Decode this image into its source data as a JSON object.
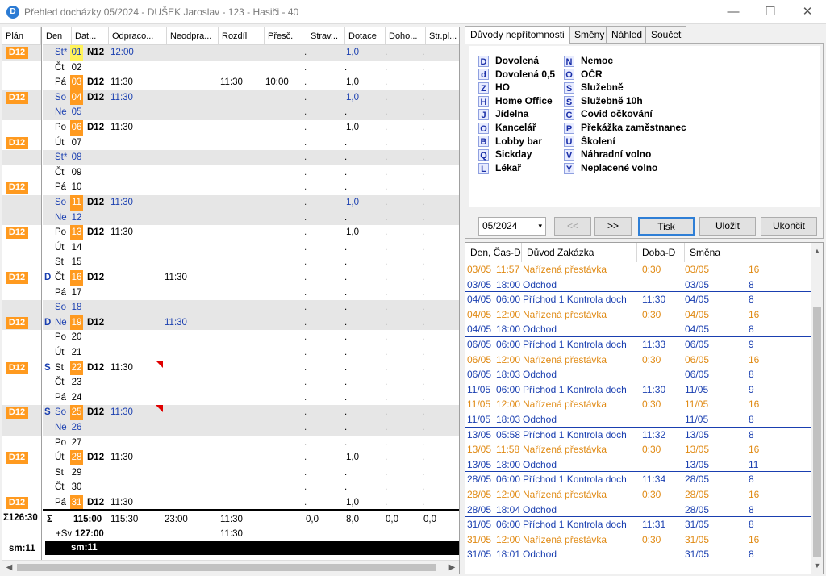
{
  "window": {
    "title": "Přehled docházky 05/2024 - DUŠEK Jaroslav - 123 - Hasiči - 40",
    "minimize": "—",
    "maximize": "☐",
    "close": "✕"
  },
  "grid": {
    "columns": [
      "Plán",
      "Den",
      "Dat...",
      "Odpraco...",
      "Neodpra...",
      "Rozdíl",
      "Přesč.",
      "Strav...",
      "Dotace",
      "Doho...",
      "Str.pl..."
    ],
    "rows": [
      {
        "plan": "D12",
        "day": "St*",
        "date": "01",
        "shift": "N12",
        "worked": "12:00",
        "unworked": "",
        "diff": "",
        "over": "",
        "meal": ".",
        "subsidy": "1,0",
        "agree": ".",
        "strpl": ".",
        "shade": true,
        "blue": true,
        "datehl": "y"
      },
      {
        "plan": "",
        "day": "Čt",
        "date": "02",
        "shift": "",
        "worked": "",
        "unworked": "",
        "diff": "",
        "over": "",
        "meal": ".",
        "subsidy": ".",
        "agree": ".",
        "strpl": ".",
        "shade": false,
        "blue": false,
        "datehl": ""
      },
      {
        "plan": "",
        "day": "Pá",
        "date": "03",
        "shift": "D12",
        "worked": "11:30",
        "unworked": "",
        "diff": "11:30",
        "over": "10:00",
        "meal": ".",
        "subsidy": "1,0",
        "agree": ".",
        "strpl": ".",
        "shade": false,
        "blue": false,
        "datehl": "o"
      },
      {
        "plan": "D12",
        "day": "So",
        "date": "04",
        "shift": "D12",
        "worked": "11:30",
        "unworked": "",
        "diff": "",
        "over": "",
        "meal": ".",
        "subsidy": "1,0",
        "agree": ".",
        "strpl": ".",
        "shade": true,
        "blue": true,
        "datehl": "o"
      },
      {
        "plan": "",
        "day": "Ne",
        "date": "05",
        "shift": "",
        "worked": "",
        "unworked": "",
        "diff": "",
        "over": "",
        "meal": ".",
        "subsidy": ".",
        "agree": ".",
        "strpl": ".",
        "shade": true,
        "blue": true,
        "datehl": ""
      },
      {
        "plan": "",
        "day": "Po",
        "date": "06",
        "shift": "D12",
        "worked": "11:30",
        "unworked": "",
        "diff": "",
        "over": "",
        "meal": ".",
        "subsidy": "1,0",
        "agree": ".",
        "strpl": ".",
        "shade": false,
        "blue": false,
        "datehl": "o"
      },
      {
        "plan": "D12",
        "day": "Út",
        "date": "07",
        "shift": "",
        "worked": "",
        "unworked": "",
        "diff": "",
        "over": "",
        "meal": ".",
        "subsidy": ".",
        "agree": ".",
        "strpl": ".",
        "shade": false,
        "blue": false,
        "datehl": ""
      },
      {
        "plan": "",
        "day": "St*",
        "date": "08",
        "shift": "",
        "worked": "",
        "unworked": "",
        "diff": "",
        "over": "",
        "meal": ".",
        "subsidy": ".",
        "agree": ".",
        "strpl": ".",
        "shade": true,
        "blue": true,
        "datehl": ""
      },
      {
        "plan": "",
        "day": "Čt",
        "date": "09",
        "shift": "",
        "worked": "",
        "unworked": "",
        "diff": "",
        "over": "",
        "meal": ".",
        "subsidy": ".",
        "agree": ".",
        "strpl": ".",
        "shade": false,
        "blue": false,
        "datehl": ""
      },
      {
        "plan": "D12",
        "day": "Pá",
        "date": "10",
        "shift": "",
        "worked": "",
        "unworked": "",
        "diff": "",
        "over": "",
        "meal": ".",
        "subsidy": ".",
        "agree": ".",
        "strpl": ".",
        "shade": false,
        "blue": false,
        "datehl": ""
      },
      {
        "plan": "",
        "day": "So",
        "date": "11",
        "shift": "D12",
        "worked": "11:30",
        "unworked": "",
        "diff": "",
        "over": "",
        "meal": ".",
        "subsidy": "1,0",
        "agree": ".",
        "strpl": ".",
        "shade": true,
        "blue": true,
        "datehl": "o"
      },
      {
        "plan": "",
        "day": "Ne",
        "date": "12",
        "shift": "",
        "worked": "",
        "unworked": "",
        "diff": "",
        "over": "",
        "meal": ".",
        "subsidy": ".",
        "agree": ".",
        "strpl": ".",
        "shade": true,
        "blue": true,
        "datehl": ""
      },
      {
        "plan": "D12",
        "day": "Po",
        "date": "13",
        "shift": "D12",
        "worked": "11:30",
        "unworked": "",
        "diff": "",
        "over": "",
        "meal": ".",
        "subsidy": "1,0",
        "agree": ".",
        "strpl": ".",
        "shade": false,
        "blue": false,
        "datehl": "o"
      },
      {
        "plan": "",
        "day": "Út",
        "date": "14",
        "shift": "",
        "worked": "",
        "unworked": "",
        "diff": "",
        "over": "",
        "meal": ".",
        "subsidy": ".",
        "agree": ".",
        "strpl": ".",
        "shade": false,
        "blue": false,
        "datehl": ""
      },
      {
        "plan": "",
        "day": "St",
        "date": "15",
        "shift": "",
        "worked": "",
        "unworked": "",
        "diff": "",
        "over": "",
        "meal": ".",
        "subsidy": ".",
        "agree": ".",
        "strpl": ".",
        "shade": false,
        "blue": false,
        "datehl": ""
      },
      {
        "plan": "D12",
        "reason": "D",
        "day": "Čt",
        "date": "16",
        "shift": "D12",
        "worked": "",
        "unworked": "11:30",
        "diff": "",
        "over": "",
        "meal": ".",
        "subsidy": ".",
        "agree": ".",
        "strpl": ".",
        "shade": false,
        "blue": false,
        "datehl": "o"
      },
      {
        "plan": "",
        "day": "Pá",
        "date": "17",
        "shift": "",
        "worked": "",
        "unworked": "",
        "diff": "",
        "over": "",
        "meal": ".",
        "subsidy": ".",
        "agree": ".",
        "strpl": ".",
        "shade": false,
        "blue": false,
        "datehl": ""
      },
      {
        "plan": "",
        "day": "So",
        "date": "18",
        "shift": "",
        "worked": "",
        "unworked": "",
        "diff": "",
        "over": "",
        "meal": ".",
        "subsidy": ".",
        "agree": ".",
        "strpl": ".",
        "shade": true,
        "blue": true,
        "datehl": ""
      },
      {
        "plan": "D12",
        "reason": "D",
        "day": "Ne",
        "date": "19",
        "shift": "D12",
        "worked": "",
        "unworked": "11:30",
        "diff": "",
        "over": "",
        "meal": ".",
        "subsidy": ".",
        "agree": ".",
        "strpl": ".",
        "shade": true,
        "blue": true,
        "datehl": "o"
      },
      {
        "plan": "",
        "day": "Po",
        "date": "20",
        "shift": "",
        "worked": "",
        "unworked": "",
        "diff": "",
        "over": "",
        "meal": ".",
        "subsidy": ".",
        "agree": ".",
        "strpl": ".",
        "shade": false,
        "blue": false,
        "datehl": ""
      },
      {
        "plan": "",
        "day": "Út",
        "date": "21",
        "shift": "",
        "worked": "",
        "unworked": "",
        "diff": "",
        "over": "",
        "meal": ".",
        "subsidy": ".",
        "agree": ".",
        "strpl": ".",
        "shade": false,
        "blue": false,
        "datehl": ""
      },
      {
        "plan": "D12",
        "reason": "S",
        "day": "St",
        "date": "22",
        "shift": "D12",
        "worked": "11:30",
        "unworked": "",
        "diff": "",
        "over": "",
        "meal": ".",
        "subsidy": ".",
        "agree": ".",
        "strpl": ".",
        "shade": false,
        "blue": false,
        "datehl": "o",
        "mark": true
      },
      {
        "plan": "",
        "day": "Čt",
        "date": "23",
        "shift": "",
        "worked": "",
        "unworked": "",
        "diff": "",
        "over": "",
        "meal": ".",
        "subsidy": ".",
        "agree": ".",
        "strpl": ".",
        "shade": false,
        "blue": false,
        "datehl": ""
      },
      {
        "plan": "",
        "day": "Pá",
        "date": "24",
        "shift": "",
        "worked": "",
        "unworked": "",
        "diff": "",
        "over": "",
        "meal": ".",
        "subsidy": ".",
        "agree": ".",
        "strpl": ".",
        "shade": false,
        "blue": false,
        "datehl": ""
      },
      {
        "plan": "D12",
        "reason": "S",
        "day": "So",
        "date": "25",
        "shift": "D12",
        "worked": "11:30",
        "unworked": "",
        "diff": "",
        "over": "",
        "meal": ".",
        "subsidy": ".",
        "agree": ".",
        "strpl": ".",
        "shade": true,
        "blue": true,
        "datehl": "o",
        "mark": true
      },
      {
        "plan": "",
        "day": "Ne",
        "date": "26",
        "shift": "",
        "worked": "",
        "unworked": "",
        "diff": "",
        "over": "",
        "meal": ".",
        "subsidy": ".",
        "agree": ".",
        "strpl": ".",
        "shade": true,
        "blue": true,
        "datehl": ""
      },
      {
        "plan": "",
        "day": "Po",
        "date": "27",
        "shift": "",
        "worked": "",
        "unworked": "",
        "diff": "",
        "over": "",
        "meal": ".",
        "subsidy": ".",
        "agree": ".",
        "strpl": ".",
        "shade": false,
        "blue": false,
        "datehl": ""
      },
      {
        "plan": "D12",
        "day": "Út",
        "date": "28",
        "shift": "D12",
        "worked": "11:30",
        "unworked": "",
        "diff": "",
        "over": "",
        "meal": ".",
        "subsidy": "1,0",
        "agree": ".",
        "strpl": ".",
        "shade": false,
        "blue": false,
        "datehl": "o"
      },
      {
        "plan": "",
        "day": "St",
        "date": "29",
        "shift": "",
        "worked": "",
        "unworked": "",
        "diff": "",
        "over": "",
        "meal": ".",
        "subsidy": ".",
        "agree": ".",
        "strpl": ".",
        "shade": false,
        "blue": false,
        "datehl": ""
      },
      {
        "plan": "",
        "day": "Čt",
        "date": "30",
        "shift": "",
        "worked": "",
        "unworked": "",
        "diff": "",
        "over": "",
        "meal": ".",
        "subsidy": ".",
        "agree": ".",
        "strpl": ".",
        "shade": false,
        "blue": false,
        "datehl": ""
      },
      {
        "plan": "D12",
        "day": "Pá",
        "date": "31",
        "shift": "D12",
        "worked": "11:30",
        "unworked": "",
        "diff": "",
        "over": "",
        "meal": ".",
        "subsidy": "1,0",
        "agree": ".",
        "strpl": ".",
        "shade": false,
        "blue": false,
        "datehl": "o"
      }
    ],
    "sum": {
      "plan": "Σ126:30",
      "sigma": "Σ",
      "total": "115:00",
      "worked": "115:30",
      "unworked": "23:00",
      "diff": "11:30",
      "meal": "0,0",
      "subsidy": "8,0",
      "agree": "0,0",
      "strpl": "0,0"
    },
    "sv": {
      "label": "+Sv",
      "total": "127:00",
      "diff": "11:30"
    },
    "sm": {
      "plan": "sm:11",
      "bar": "sm:11"
    }
  },
  "tabs": [
    "Důvody nepřítomnosti",
    "Směny",
    "Náhled",
    "Součet"
  ],
  "legend": [
    {
      "key": "D",
      "label": "Dovolená"
    },
    {
      "key": "d",
      "label": "Dovolená 0,5"
    },
    {
      "key": "Z",
      "label": "HO"
    },
    {
      "key": "H",
      "label": "Home Office"
    },
    {
      "key": "J",
      "label": "Jídelna"
    },
    {
      "key": "O",
      "label": "Kancelář"
    },
    {
      "key": "B",
      "label": "Lobby bar"
    },
    {
      "key": "Q",
      "label": "Sickday"
    },
    {
      "key": "L",
      "label": "Lékař"
    },
    {
      "key": "N",
      "label": "Nemoc"
    },
    {
      "key": "O",
      "label": "OČR"
    },
    {
      "key": "S",
      "label": "Služebně"
    },
    {
      "key": "S",
      "label": "Služebně 10h"
    },
    {
      "key": "C",
      "label": "Covid očkování"
    },
    {
      "key": "P",
      "label": "Překážka zaměstnanec"
    },
    {
      "key": "U",
      "label": "Školení"
    },
    {
      "key": "V",
      "label": "Náhradní volno"
    },
    {
      "key": "Y",
      "label": "Neplacené volno"
    }
  ],
  "controls": {
    "month": "05/2024",
    "prev": "<<",
    "next": ">>",
    "print": "Tisk",
    "save": "Uložit",
    "exit": "Ukončit"
  },
  "events": {
    "columns": [
      "Den, Čas-D",
      "Důvod Zakázka",
      "Doba-D",
      "Směna"
    ],
    "rows": [
      {
        "date": "03/05",
        "time": "11:57",
        "reason": "Nařízená přestávka",
        "dur": "0:30",
        "shift": "03/05",
        "n": "16",
        "color": "orange",
        "sep": false
      },
      {
        "date": "03/05",
        "time": "18:00",
        "reason": "Odchod",
        "dur": "",
        "shift": "03/05",
        "n": "8",
        "color": "blue",
        "sep": true
      },
      {
        "date": "04/05",
        "time": "06:00",
        "reason": "Příchod 1 Kontrola doch",
        "dur": "11:30",
        "shift": "04/05",
        "n": "8",
        "color": "blue",
        "sep": false
      },
      {
        "date": "04/05",
        "time": "12:00",
        "reason": "Nařízená přestávka",
        "dur": "0:30",
        "shift": "04/05",
        "n": "16",
        "color": "orange",
        "sep": false
      },
      {
        "date": "04/05",
        "time": "18:00",
        "reason": "Odchod",
        "dur": "",
        "shift": "04/05",
        "n": "8",
        "color": "blue",
        "sep": true
      },
      {
        "date": "06/05",
        "time": "06:00",
        "reason": "Příchod 1 Kontrola doch",
        "dur": "11:33",
        "shift": "06/05",
        "n": "9",
        "color": "blue",
        "sep": false
      },
      {
        "date": "06/05",
        "time": "12:00",
        "reason": "Nařízená přestávka",
        "dur": "0:30",
        "shift": "06/05",
        "n": "16",
        "color": "orange",
        "sep": false
      },
      {
        "date": "06/05",
        "time": "18:03",
        "reason": "Odchod",
        "dur": "",
        "shift": "06/05",
        "n": "8",
        "color": "blue",
        "sep": true
      },
      {
        "date": "11/05",
        "time": "06:00",
        "reason": "Příchod 1 Kontrola doch",
        "dur": "11:30",
        "shift": "11/05",
        "n": "9",
        "color": "blue",
        "sep": false
      },
      {
        "date": "11/05",
        "time": "12:00",
        "reason": "Nařízená přestávka",
        "dur": "0:30",
        "shift": "11/05",
        "n": "16",
        "color": "orange",
        "sep": false
      },
      {
        "date": "11/05",
        "time": "18:03",
        "reason": "Odchod",
        "dur": "",
        "shift": "11/05",
        "n": "8",
        "color": "blue",
        "sep": true
      },
      {
        "date": "13/05",
        "time": "05:58",
        "reason": "Příchod 1 Kontrola doch",
        "dur": "11:32",
        "shift": "13/05",
        "n": "8",
        "color": "blue",
        "sep": false
      },
      {
        "date": "13/05",
        "time": "11:58",
        "reason": "Nařízená přestávka",
        "dur": "0:30",
        "shift": "13/05",
        "n": "16",
        "color": "orange",
        "sep": false
      },
      {
        "date": "13/05",
        "time": "18:00",
        "reason": "Odchod",
        "dur": "",
        "shift": "13/05",
        "n": "11",
        "color": "blue",
        "sep": true
      },
      {
        "date": "28/05",
        "time": "06:00",
        "reason": "Příchod 1 Kontrola doch",
        "dur": "11:34",
        "shift": "28/05",
        "n": "8",
        "color": "blue",
        "sep": false
      },
      {
        "date": "28/05",
        "time": "12:00",
        "reason": "Nařízená přestávka",
        "dur": "0:30",
        "shift": "28/05",
        "n": "16",
        "color": "orange",
        "sep": false
      },
      {
        "date": "28/05",
        "time": "18:04",
        "reason": "Odchod",
        "dur": "",
        "shift": "28/05",
        "n": "8",
        "color": "blue",
        "sep": true
      },
      {
        "date": "31/05",
        "time": "06:00",
        "reason": "Příchod 1 Kontrola doch",
        "dur": "11:31",
        "shift": "31/05",
        "n": "8",
        "color": "blue",
        "sep": false
      },
      {
        "date": "31/05",
        "time": "12:00",
        "reason": "Nařízená přestávka",
        "dur": "0:30",
        "shift": "31/05",
        "n": "16",
        "color": "orange",
        "sep": false
      },
      {
        "date": "31/05",
        "time": "18:01",
        "reason": "Odchod",
        "dur": "",
        "shift": "31/05",
        "n": "8",
        "color": "blue",
        "sep": false
      }
    ]
  }
}
